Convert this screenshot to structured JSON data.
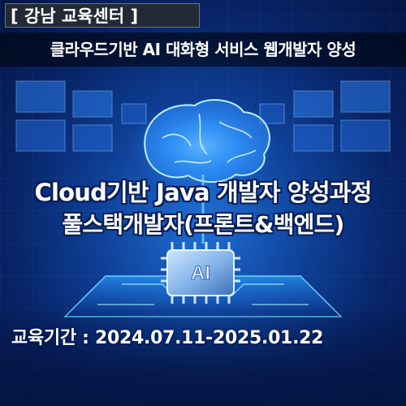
{
  "tag": "[ 강남 교육센터 ]",
  "subtitle": "클라우드기반 AI 대화형 서비스 웹개발자 양성",
  "title_line1": "Cloud기반 Java 개발자 양성과정",
  "title_line2": "풀스택개발자(프론트&백엔드)",
  "chip_label": "AI",
  "period_text": "교육기간 : 2024.07.11-2025.01.22",
  "colors": {
    "background_dark": "#041544",
    "background_glow": "#1f6fd6",
    "tag_box": "#232a35",
    "text": "#ffffff",
    "accent_cyan": "#5fd2ff"
  }
}
